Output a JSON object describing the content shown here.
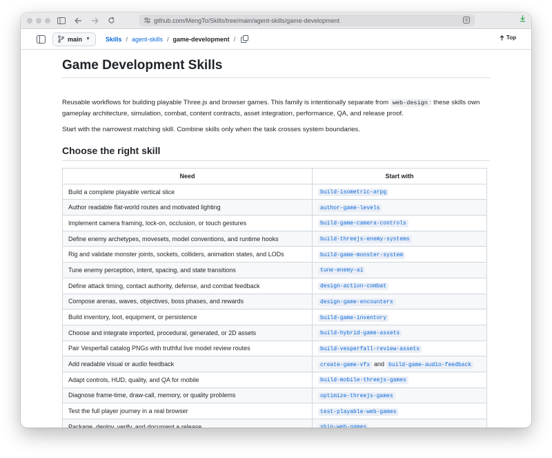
{
  "browser": {
    "url": "github.com/MengTo/Skills/tree/main/agent-skills/game-development"
  },
  "filebar": {
    "branch": "main",
    "breadcrumb": [
      "Skills",
      "agent-skills"
    ],
    "current": "game-development",
    "top_label": "Top"
  },
  "doc": {
    "title": "Game Development Skills",
    "intro_before": "Reusable workflows for building playable Three.js and browser games. This family is intentionally separate from ",
    "intro_code": "web-design",
    "intro_after": ": these skills own gameplay architecture, simulation, combat, content contracts, asset integration, performance, QA, and release proof.",
    "guidance": "Start with the narrowest matching skill. Combine skills only when the task crosses system boundaries.",
    "section_title": "Choose the right skill",
    "table": {
      "headers": [
        "Need",
        "Start with"
      ],
      "rows": [
        {
          "need": "Build a complete playable vertical slice",
          "skills": [
            "build-isometric-arpg"
          ]
        },
        {
          "need": "Author readable flat-world routes and motivated lighting",
          "skills": [
            "author-game-levels"
          ]
        },
        {
          "need": "Implement camera framing, lock-on, occlusion, or touch gestures",
          "skills": [
            "build-game-camera-controls"
          ]
        },
        {
          "need": "Define enemy archetypes, movesets, model conventions, and runtime hooks",
          "skills": [
            "build-threejs-enemy-systems"
          ]
        },
        {
          "need": "Rig and validate monster joints, sockets, colliders, animation states, and LODs",
          "skills": [
            "build-game-monster-system"
          ]
        },
        {
          "need": "Tune enemy perception, intent, spacing, and state transitions",
          "skills": [
            "tune-enemy-ai"
          ]
        },
        {
          "need": "Define attack timing, contact authority, defense, and combat feedback",
          "skills": [
            "design-action-combat"
          ]
        },
        {
          "need": "Compose arenas, waves, objectives, boss phases, and rewards",
          "skills": [
            "design-game-encounters"
          ]
        },
        {
          "need": "Build inventory, loot, equipment, or persistence",
          "skills": [
            "build-game-inventory"
          ]
        },
        {
          "need": "Choose and integrate imported, procedural, generated, or 2D assets",
          "skills": [
            "build-hybrid-game-assets"
          ]
        },
        {
          "need": "Pair Vesperfall catalog PNGs with truthful live model review routes",
          "skills": [
            "build-vesperfall-review-assets"
          ]
        },
        {
          "need": "Add readable visual or audio feedback",
          "skills": [
            "create-game-vfx",
            "build-game-audio-feedback"
          ],
          "joiner": "and"
        },
        {
          "need": "Adapt controls, HUD, quality, and QA for mobile",
          "skills": [
            "build-mobile-threejs-games"
          ]
        },
        {
          "need": "Diagnose frame-time, draw-call, memory, or quality problems",
          "skills": [
            "optimize-threejs-games"
          ]
        },
        {
          "need": "Test the full player journey in a real browser",
          "skills": [
            "test-playable-web-games"
          ]
        },
        {
          "need": "Package, deploy, verify, and document a release",
          "skills": [
            "ship-web-games"
          ]
        }
      ]
    }
  }
}
